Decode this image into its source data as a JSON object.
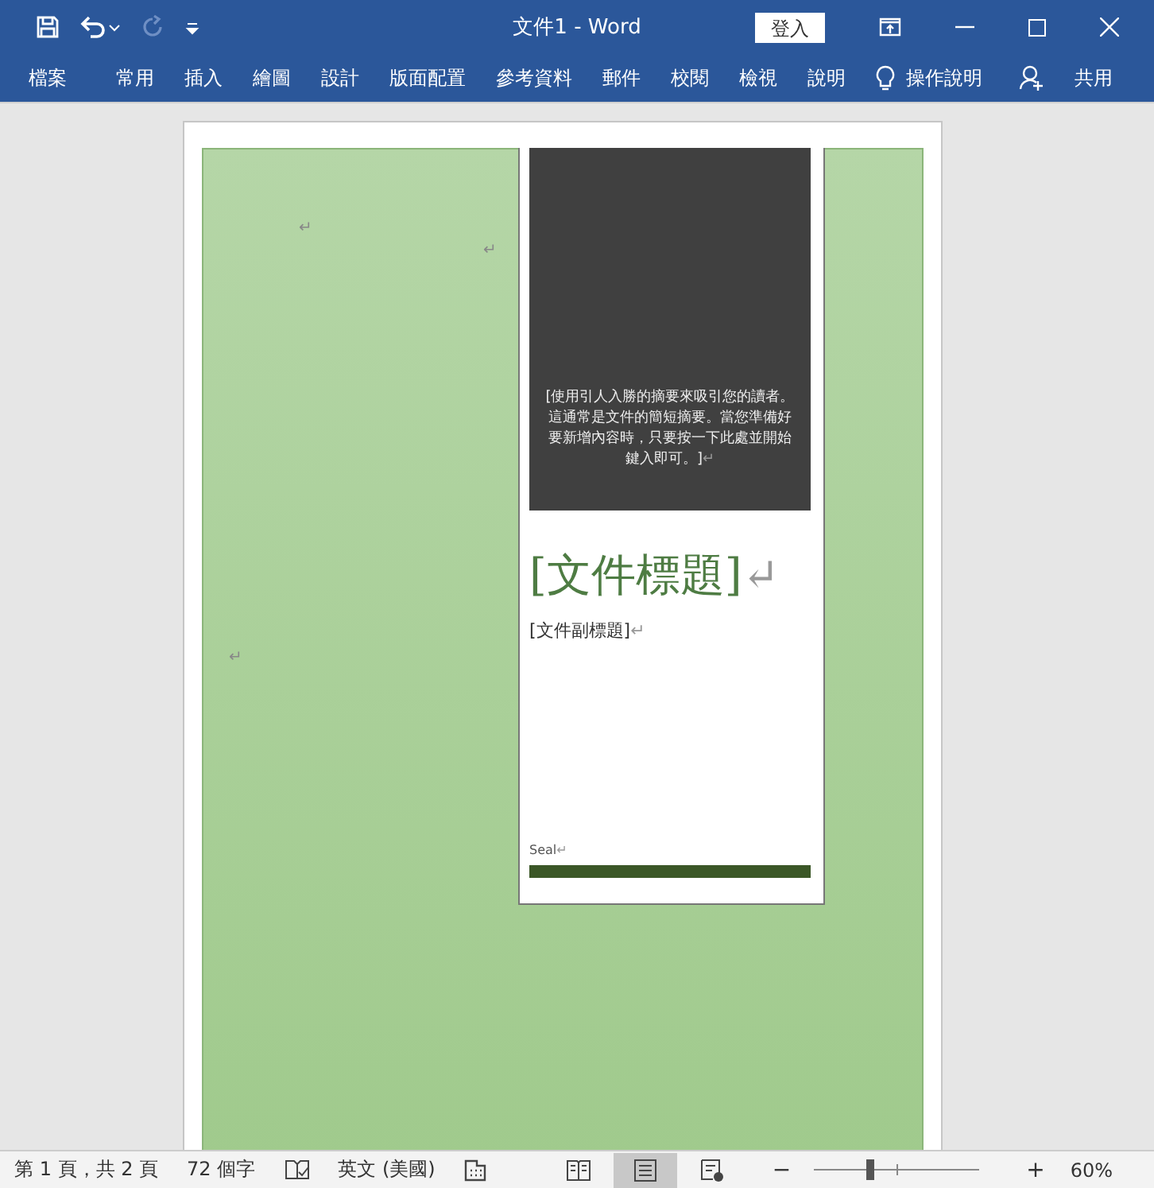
{
  "window": {
    "title": "文件1  -  Word",
    "sign_in": "登入"
  },
  "ribbon_tabs": [
    "檔案",
    "常用",
    "插入",
    "繪圖",
    "設計",
    "版面配置",
    "參考資料",
    "郵件",
    "校閱",
    "檢視",
    "說明"
  ],
  "tell_me": "操作說明",
  "share": "共用",
  "document": {
    "stray_marks": [
      "↵",
      "↵",
      "↵"
    ],
    "abstract": {
      "text": "[使用引人入勝的摘要來吸引您的讀者。這通常是文件的簡短摘要。當您準備好要新增內容時，只要按一下此處並開始鍵入即可。]",
      "mark": "↵"
    },
    "title": {
      "text": "[文件標題]",
      "mark": "↵"
    },
    "subtitle": {
      "text": "[文件副標題]",
      "mark": "↵"
    },
    "author": {
      "text": "Seal",
      "mark": "↵"
    }
  },
  "status_bar": {
    "page": "第 1 頁，共 2 頁",
    "words": "72 個字",
    "language": "英文 (美國)",
    "views": [
      {
        "kind": "read",
        "selected": false
      },
      {
        "kind": "print",
        "selected": true
      },
      {
        "kind": "web",
        "selected": false
      }
    ],
    "zoom_out": "−",
    "zoom_in": "+",
    "zoom": {
      "level": 0.33
    },
    "zoom_label": "60%"
  }
}
